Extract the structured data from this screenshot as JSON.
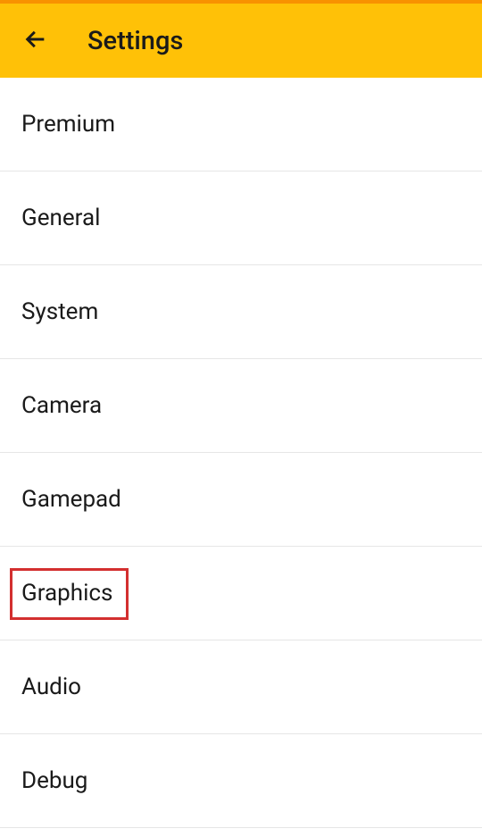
{
  "header": {
    "title": "Settings"
  },
  "menu": {
    "items": [
      {
        "label": "Premium",
        "highlighted": false
      },
      {
        "label": "General",
        "highlighted": false
      },
      {
        "label": "System",
        "highlighted": false
      },
      {
        "label": "Camera",
        "highlighted": false
      },
      {
        "label": "Gamepad",
        "highlighted": false
      },
      {
        "label": "Graphics",
        "highlighted": true
      },
      {
        "label": "Audio",
        "highlighted": false
      },
      {
        "label": "Debug",
        "highlighted": false
      }
    ]
  },
  "colors": {
    "accent": "#ffc107",
    "accentDark": "#f89200",
    "highlight": "#d32f2f"
  }
}
